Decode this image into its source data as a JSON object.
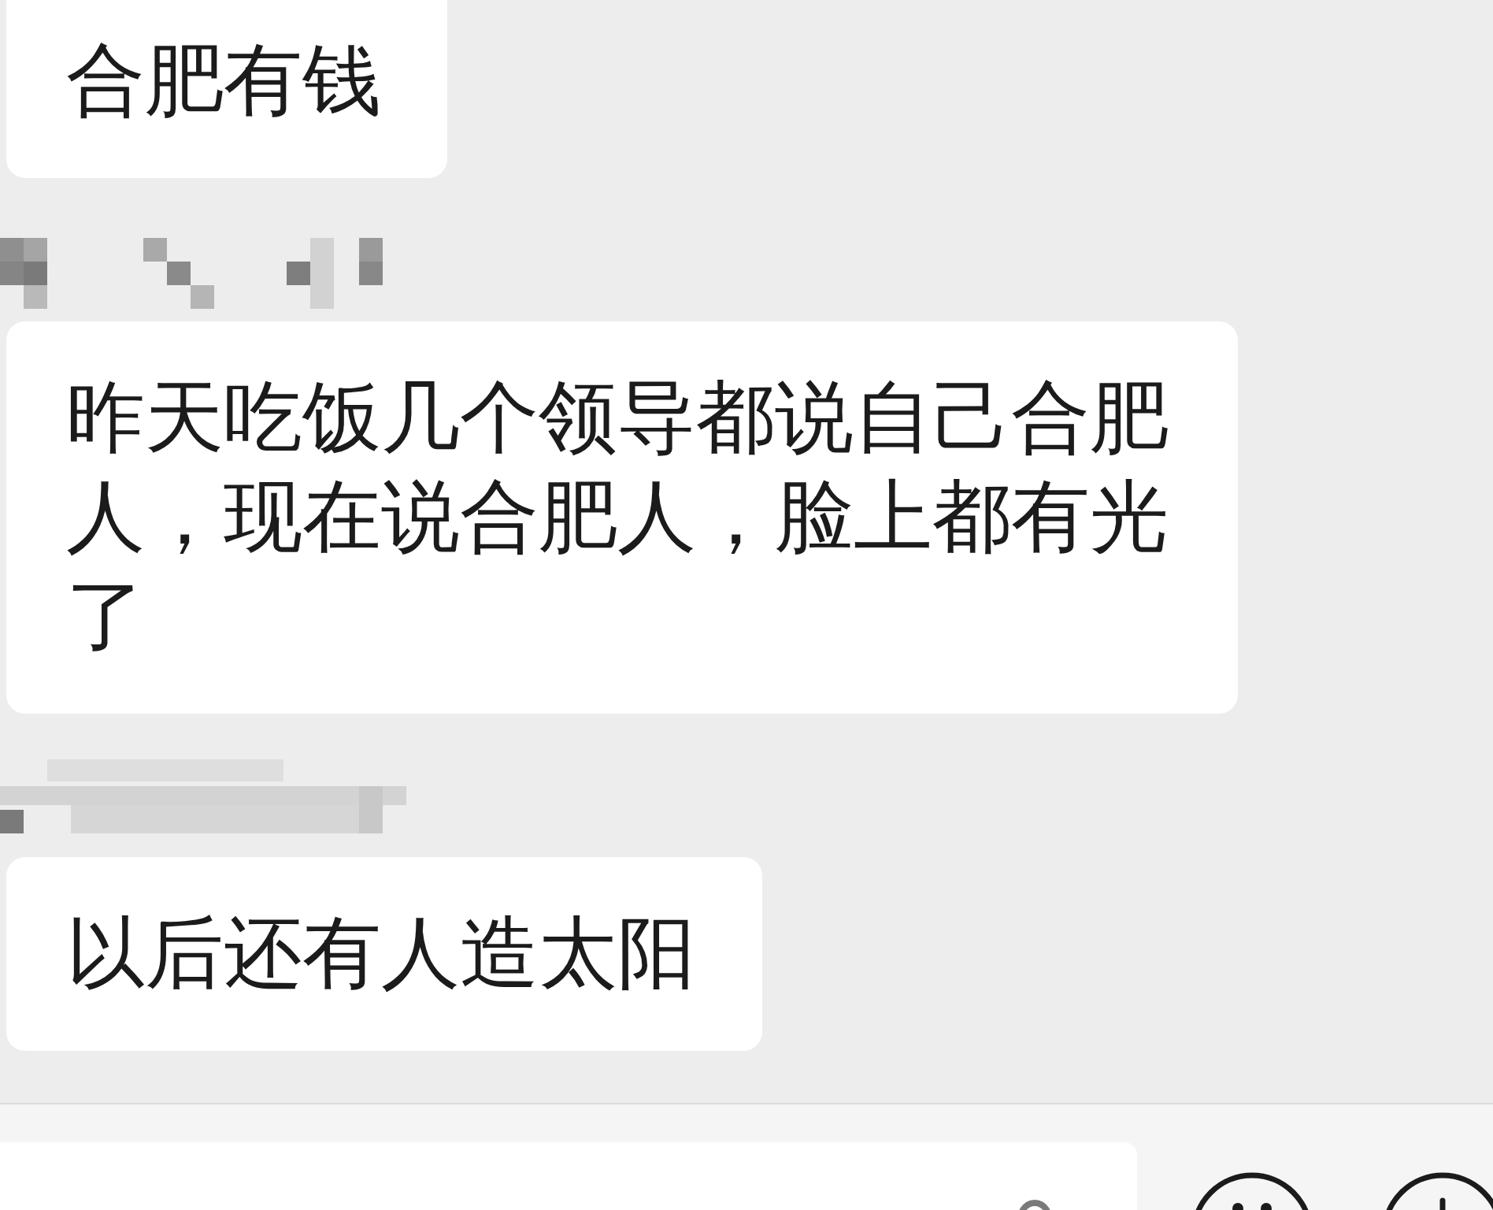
{
  "chat": {
    "items": [
      {
        "kind": "message",
        "text": "合肥有钱"
      },
      {
        "kind": "redacted_name"
      },
      {
        "kind": "message",
        "text": "昨天吃饭几个领导都说自己合肥人，现在说合肥人，脸上都有光了"
      },
      {
        "kind": "redacted_name"
      },
      {
        "kind": "message",
        "text": "以后还有人造太阳"
      }
    ]
  }
}
